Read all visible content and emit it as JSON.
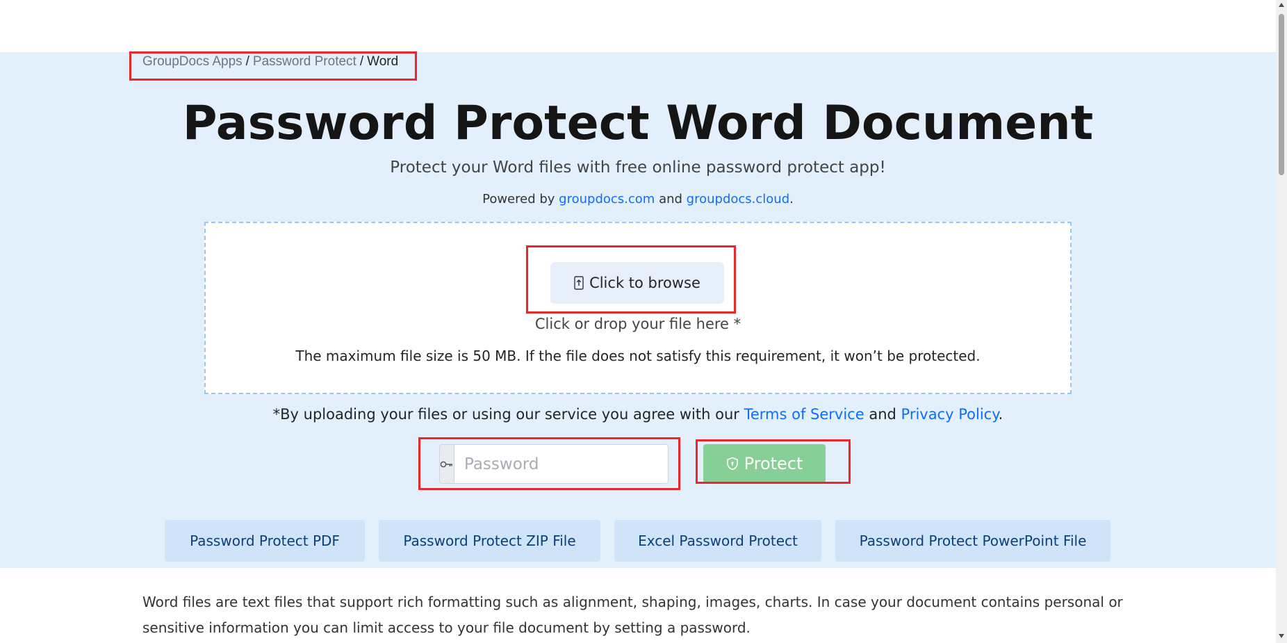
{
  "breadcrumb": {
    "items": [
      "GroupDocs Apps",
      "Password Protect",
      "Word"
    ],
    "separator": "/"
  },
  "hero": {
    "title": "Password Protect Word Document",
    "subtitle": "Protect your Word files with free online password protect app!",
    "powered_prefix": "Powered by",
    "powered_link1": "groupdocs.com",
    "powered_and": "and",
    "powered_link2": "groupdocs.cloud",
    "powered_suffix": "."
  },
  "upload": {
    "browse_label": "Click to browse",
    "browse_icon": "file-upload-icon",
    "drop_hint": "Click or drop your file here *",
    "max_size_note": "The maximum file size is 50 MB. If the file does not satisfy this requirement, it won’t be protected."
  },
  "terms": {
    "prefix": "*By uploading your files or using our service you agree with our",
    "tos_link": "Terms of Service",
    "and": "and",
    "privacy_link": "Privacy Policy",
    "suffix": "."
  },
  "protect_form": {
    "password_placeholder": "Password",
    "password_value": "",
    "key_icon": "key-icon",
    "protect_label": "Protect",
    "protect_icon": "shield-icon"
  },
  "related_apps": [
    "Password Protect PDF",
    "Password Protect ZIP File",
    "Excel Password Protect",
    "Password Protect PowerPoint File"
  ],
  "description": "Word files are text files that support rich formatting such as alignment, shaping, images, charts. In case your document contains personal or sensitive information you can limit access to your file document by setting a password.",
  "colors": {
    "hero_background": "#e3f0fb",
    "link": "#0d6efd",
    "protect_button": "#86cf96",
    "related_button": "#cfe4f8",
    "highlight": "#e8282b"
  }
}
